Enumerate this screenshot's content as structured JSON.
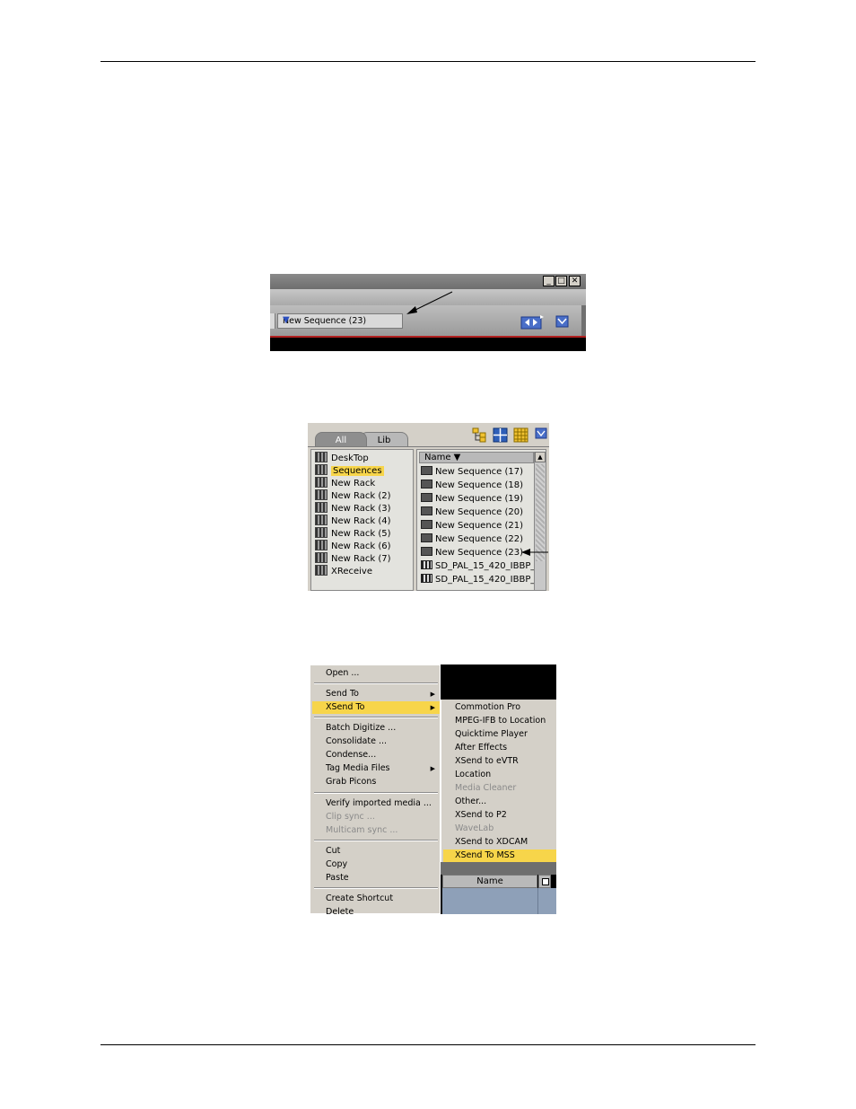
{
  "screenshot1": {
    "sequence_dropdown_value": "New Sequence (23)"
  },
  "screenshot2": {
    "tabs": [
      "All",
      "Lib"
    ],
    "tree_items": [
      "DeskTop",
      "Sequences",
      "New Rack",
      "New Rack (2)",
      "New Rack (3)",
      "New Rack (4)",
      "New Rack (5)",
      "New Rack (6)",
      "New Rack (7)",
      "XReceive"
    ],
    "selected_tree_item": "Sequences",
    "list_header": "Name ▼",
    "list_items": [
      "New Sequence (17)",
      "New Sequence (18)",
      "New Sequence (19)",
      "New Sequence (20)",
      "New Sequence (21)",
      "New Sequence (22)",
      "New Sequence (23)",
      "SD_PAL_15_420_IBBP_...",
      "SD_PAL_15_420_IBBP_..."
    ]
  },
  "screenshot3": {
    "menu_items": [
      "Open ...",
      "Send To",
      "XSend To",
      "Batch Digitize ...",
      "Consolidate ...",
      "Condense...",
      "Tag Media Files",
      "Grab Picons",
      "Verify imported media ...",
      "Clip sync ...",
      "Multicam sync ...",
      "Cut",
      "Copy",
      "Paste",
      "Create Shortcut",
      "Delete"
    ],
    "submenu_items": [
      "Commotion Pro",
      "MPEG-IFB to Location",
      "Quicktime Player",
      "After Effects",
      "XSend to eVTR",
      "Location",
      "Media Cleaner",
      "Other...",
      "XSend to P2",
      "WaveLab",
      "XSend to XDCAM",
      "XSend To MSS"
    ],
    "column_header": "Name"
  },
  "colors": {
    "highlight": "#f7d54a",
    "menu_bg": "#d4d0c8",
    "arrow_accent": "#2b4fbf"
  }
}
